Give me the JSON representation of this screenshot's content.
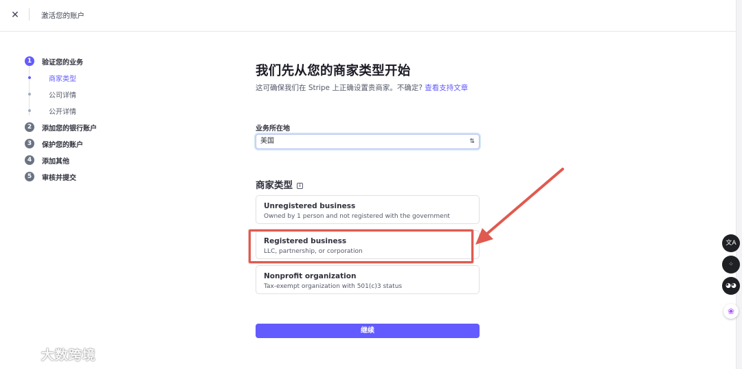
{
  "topbar": {
    "close_icon": "close-icon",
    "title": "激活您的账户"
  },
  "sidebar": {
    "steps": [
      {
        "num": "1",
        "label": "验证您的业务",
        "active": true,
        "substeps": [
          {
            "label": "商家类型",
            "active": true
          },
          {
            "label": "公司详情",
            "active": false
          },
          {
            "label": "公开详情",
            "active": false
          }
        ]
      },
      {
        "num": "2",
        "label": "添加您的银行账户"
      },
      {
        "num": "3",
        "label": "保护您的账户"
      },
      {
        "num": "4",
        "label": "添加其他"
      },
      {
        "num": "5",
        "label": "审核并提交"
      }
    ]
  },
  "main": {
    "heading": "我们先从您的商家类型开始",
    "subtitle_text": "这可确保我们在 Stripe 上正确设置贵商家。不确定? ",
    "subtitle_link": "查看支持文章",
    "location": {
      "label": "业务所在地",
      "value": "美国"
    },
    "business_type": {
      "title": "商家类型",
      "options": [
        {
          "title": "Unregistered business",
          "desc": "Owned by 1 person and not registered with the government"
        },
        {
          "title": "Registered business",
          "desc": "LLC, partnership, or corporation"
        },
        {
          "title": "Nonprofit organization",
          "desc": "Tax-exempt organization with 501(c)3 status"
        }
      ]
    },
    "continue_label": "继续"
  },
  "annotation": {
    "color": "#e05a4f",
    "highlighted_option": "Registered business"
  },
  "colors": {
    "accent": "#635bff",
    "text": "#30313d",
    "muted": "#545969"
  },
  "watermark": {
    "text": "大数跨境"
  }
}
